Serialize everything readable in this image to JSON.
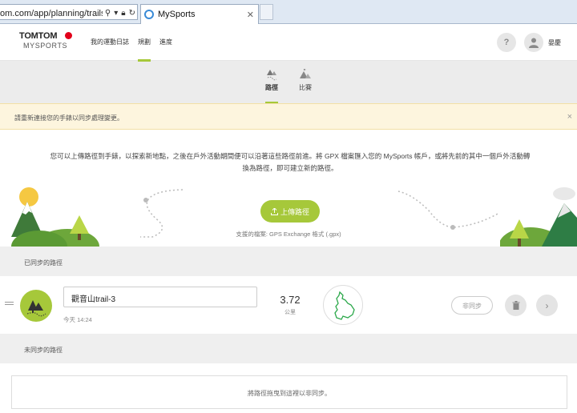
{
  "browser": {
    "url": "om.com/app/planning/trails/",
    "tab_title": "MySports"
  },
  "header": {
    "logo_top": "TOMTOM",
    "logo_bottom": "MYSPORTS",
    "nav": [
      "我的運動日誌",
      "規劃",
      "進度"
    ],
    "active_nav": "規劃",
    "help_symbol": "?",
    "user_name": "晏慶"
  },
  "subtabs": [
    {
      "label": "路徑",
      "icon": "trail-icon",
      "active": true
    },
    {
      "label": "比賽",
      "icon": "race-icon",
      "active": false
    }
  ],
  "notice": {
    "text": "請重新連接您的手錶以同步處理變更。",
    "close": "×"
  },
  "upload": {
    "intro": "您可以上傳路徑到手錶，以探索新地點，之後在戶外活動期間便可以沿著這些路徑前進。將 GPX 檔案匯入您的 MySports 帳戶，或將先前的其中一個戶外活動轉換為路徑，即可建立新的路徑。",
    "button_label": "上傳路徑",
    "formats": "支援的檔案: GPS Exchange 格式 (.gpx)"
  },
  "synced": {
    "heading": "已同步的路徑",
    "routes": [
      {
        "name": "觀音山trail-3",
        "time": "今天 14:24",
        "distance": "3.72",
        "unit": "公里",
        "unsync_label": "非同步"
      }
    ]
  },
  "unsynced": {
    "heading": "未同步的路徑",
    "drop_text": "將路徑拖曳到這裡以非同步。"
  },
  "colors": {
    "accent": "#a6c83a",
    "notice_bg": "#fdf5de",
    "brand_red": "#e2001a"
  }
}
